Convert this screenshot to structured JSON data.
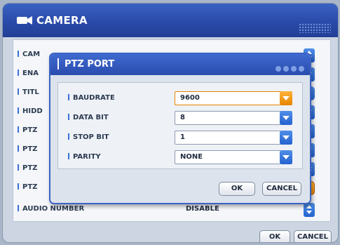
{
  "window": {
    "title": "CAMERA"
  },
  "background_rows": [
    {
      "label": "CAM",
      "value": ""
    },
    {
      "label": "ENA",
      "value": ""
    },
    {
      "label": "TITL",
      "value": ""
    },
    {
      "label": "HIDD",
      "value": ""
    },
    {
      "label": "PTZ",
      "value": ""
    },
    {
      "label": "PTZ",
      "value": ""
    },
    {
      "label": "PTZ",
      "value": ""
    },
    {
      "label": "PTZ",
      "value": ""
    },
    {
      "label": "AUDIO NUMBER",
      "value": "DISABLE"
    }
  ],
  "dialog": {
    "title": "PTZ PORT",
    "fields": [
      {
        "label": "BAUDRATE",
        "value": "9600"
      },
      {
        "label": "DATA BIT",
        "value": "8"
      },
      {
        "label": "STOP BIT",
        "value": "1"
      },
      {
        "label": "PARITY",
        "value": "NONE"
      }
    ],
    "ok_label": "OK",
    "cancel_label": "CANCEL"
  },
  "footer": {
    "ok_label": "OK",
    "cancel_label": "CANCEL"
  },
  "colors": {
    "accent": "#2a4aa9",
    "highlight": "#e58500"
  }
}
